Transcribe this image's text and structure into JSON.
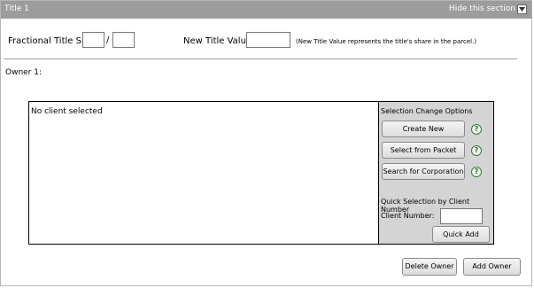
{
  "section": {
    "title": "Title 1",
    "hide_label": "Hide this section"
  },
  "fraction": {
    "label": "Fractional Title Share:",
    "separator": "/",
    "numerator": "",
    "denominator": ""
  },
  "new_value": {
    "label": "New Title Value: $",
    "value": "",
    "note": "(New Title Value represents the title's share in the parcel.)"
  },
  "owner": {
    "label": "Owner 1:",
    "client_status": "No client selected"
  },
  "options": {
    "heading": "Selection Change Options",
    "create_new": "Create New",
    "select_from_packet": "Select from Packet",
    "search_corporation": "Search for Corporation",
    "help_glyph": "?",
    "quick_heading": "Quick Selection by Client Number",
    "client_number_label": "Client Number:",
    "client_number_value": "",
    "quick_add": "Quick Add"
  },
  "footer": {
    "delete_owner": "Delete Owner",
    "add_owner": "Add Owner"
  },
  "icons": {
    "collapse": "collapse-section-icon",
    "help": "help-icon"
  },
  "colors": {
    "header_bg": "#9c9c9c",
    "options_bg": "#d4d4d4",
    "help_green": "#2d6e2d"
  }
}
